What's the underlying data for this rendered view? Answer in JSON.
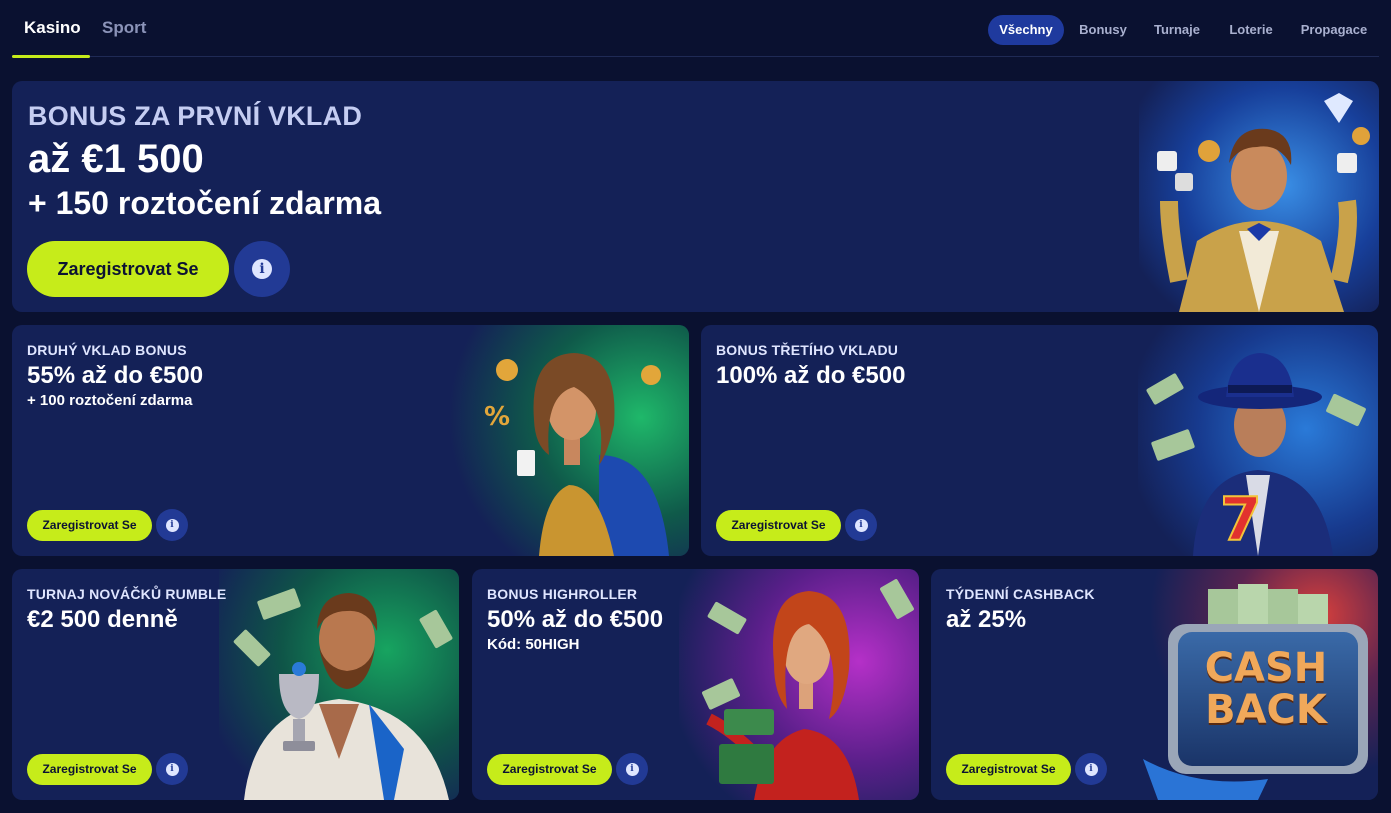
{
  "nav": {
    "main_tabs": [
      {
        "label": "Kasino",
        "active": true
      },
      {
        "label": "Sport",
        "active": false
      }
    ],
    "filter_tabs": [
      {
        "label": "Všechny",
        "active": true
      },
      {
        "label": "Bonusy",
        "active": false
      },
      {
        "label": "Turnaje",
        "active": false
      },
      {
        "label": "Loterie",
        "active": false
      },
      {
        "label": "Propagace",
        "active": false
      }
    ]
  },
  "hero": {
    "label": "BONUS ZA PRVNÍ VKLAD",
    "value": "až €1 500",
    "sub": "+ 150 roztočení zdarma",
    "button": "Zaregistrovat Se",
    "info_icon": "info-icon",
    "art_icon": "gentleman-with-dice-illustration"
  },
  "cards": [
    {
      "label": "DRUHÝ VKLAD BONUS",
      "value": "55% až do €500",
      "sub": "+ 100 roztočení zdarma",
      "button": "Zaregistrovat Se",
      "art_icon": "woman-gold-dress-illustration",
      "accent": "#18a05a"
    },
    {
      "label": "BONUS TŘETÍHO VKLADU",
      "value": "100% až do €500",
      "sub": "",
      "button": "Zaregistrovat Se",
      "art_icon": "man-in-fedora-illustration",
      "accent": "#2a6fd6"
    },
    {
      "label": "TURNAJ NOVÁČKŮ RUMBLE",
      "value": "€2 500 denně",
      "sub": "",
      "button": "Zaregistrovat Se",
      "art_icon": "bearded-man-trophy-illustration",
      "accent": "#14985a"
    },
    {
      "label": "BONUS HIGHROLLER",
      "value": "50% až do €500",
      "sub": "Kód: 50HIGH",
      "button": "Zaregistrovat Se",
      "art_icon": "red-haired-woman-illustration",
      "accent": "#9b2ab8"
    },
    {
      "label": "TÝDENNÍ CASHBACK",
      "value": "až 25%",
      "sub": "",
      "button": "Zaregistrovat Se",
      "art_icon": "cashback-sign-illustration",
      "art_text": [
        "CASH",
        "BACK"
      ],
      "accent": "#d23a3a"
    }
  ],
  "colors": {
    "background": "#0a1130",
    "card": "#142157",
    "cta": "#c6ec1a",
    "info": "#223a95",
    "active_filter": "#1f3a9e"
  }
}
